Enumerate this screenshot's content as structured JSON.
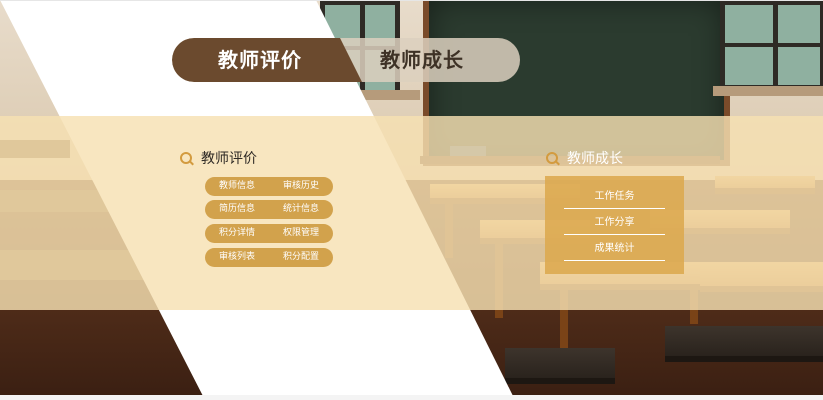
{
  "tabs": {
    "active_label": "教师评价",
    "inactive_label": "教师成长"
  },
  "left_section": {
    "title": "教师评价",
    "icon": "search-icon",
    "rows": [
      [
        "教师信息",
        "审核历史"
      ],
      [
        "简历信息",
        "统计信息"
      ],
      [
        "积分详情",
        "权限管理"
      ],
      [
        "审核列表",
        "积分配置"
      ]
    ]
  },
  "right_section": {
    "title": "教师成长",
    "icon": "search-icon",
    "items": [
      "工作任务",
      "工作分享",
      "成果统计"
    ]
  },
  "colors": {
    "tab_active": "#6b4a2e",
    "pill": "#d2a24c",
    "accent_icon": "#d39b3f",
    "menu_box": "#dca84e",
    "cream_band": "#f6e0b2"
  }
}
